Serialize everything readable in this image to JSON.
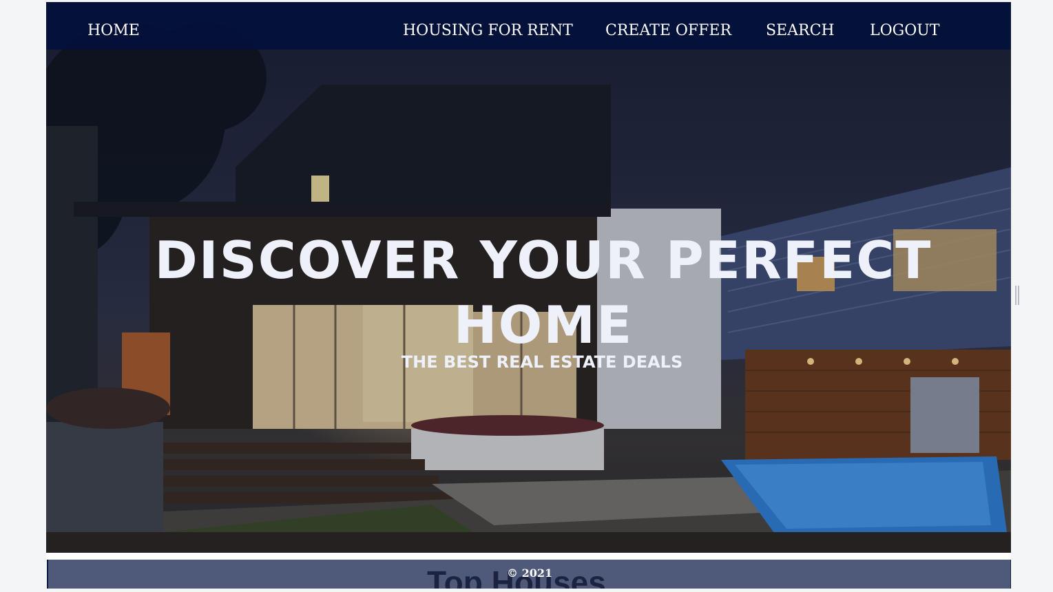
{
  "navbar": {
    "home": "HOME",
    "housing_for_rent": "HOUSING FOR RENT",
    "create_offer": "CREATE OFFER",
    "search": "SEARCH",
    "logout": "LOGOUT"
  },
  "hero": {
    "title": "DISCOVER YOUR PERFECT HOME",
    "subtitle": "THE BEST REAL ESTATE DEALS",
    "image": "modern-house-night-photo"
  },
  "section": {
    "heading": "Top Houses"
  },
  "footer": {
    "copyright": "© 2021"
  },
  "colors": {
    "navbar_bg": "#03103a",
    "hero_text": "#eef0fa",
    "section_bar": "#4f5a7a"
  }
}
